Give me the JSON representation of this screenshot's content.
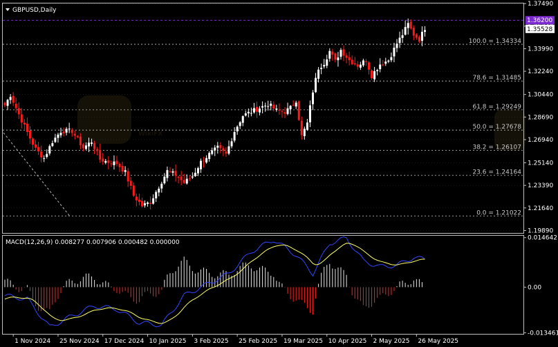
{
  "header": {
    "symbol_label": "GBPUSD,Daily"
  },
  "macd": {
    "label": "MACD(12,26,9) 0.008277 0.007906 0.000482 0.000000"
  },
  "colors": {
    "background": "#000000",
    "frame": "#c0c0c0",
    "grid": "#3a3a3a",
    "bull": "#ffffff",
    "bear": "#ff1a1a",
    "fib": "#c8c8c8",
    "dashed_trend": "#bbbbbb",
    "high_line": "#a040ff",
    "macd_line": "#3344ff",
    "signal_line": "#ffff66",
    "hist_pos": "#e8e8e8",
    "hist_neg": "#ff2020"
  },
  "price_axis": {
    "min": 1.197,
    "max": 1.375,
    "ticks": [
      "1.37490",
      "1.35740",
      "1.33990",
      "1.32240",
      "1.30440",
      "1.28690",
      "1.26940",
      "1.25140",
      "1.23390",
      "1.21640",
      "1.19890"
    ],
    "tick_values": [
      1.3749,
      1.3574,
      1.3399,
      1.3224,
      1.3044,
      1.2869,
      1.2694,
      1.2514,
      1.2339,
      1.2164,
      1.1989
    ]
  },
  "price_badges": [
    {
      "label": "1.36200",
      "value": 1.362,
      "style": "purple"
    },
    {
      "label": "1.35528",
      "value": 1.35528,
      "style": "white"
    }
  ],
  "fib_levels": [
    {
      "label": "100.0 = 1.34334",
      "value": 1.34334
    },
    {
      "label": "78.6 = 1.31485",
      "value": 1.31485
    },
    {
      "label": "61.8 = 1.29249",
      "value": 1.29249
    },
    {
      "label": "50.0 = 1.27678",
      "value": 1.27678
    },
    {
      "label": "38.2 = 1.26107",
      "value": 1.26107
    },
    {
      "label": "23.6 = 1.24164",
      "value": 1.24164
    },
    {
      "label": "0.0 = 1.21022",
      "value": 1.21022
    }
  ],
  "macd_axis": {
    "min": -0.0138,
    "max": 0.0152,
    "ticks": [
      "0.014642",
      "0.00",
      "-0.013461"
    ],
    "tick_values": [
      0.014642,
      0.0,
      -0.013461
    ]
  },
  "date_labels": [
    {
      "label": "1 Nov 2024",
      "bar": 3
    },
    {
      "label": "25 Nov 2024",
      "bar": 19
    },
    {
      "label": "17 Dec 2024",
      "bar": 35
    },
    {
      "label": "10 Jan 2025",
      "bar": 51
    },
    {
      "label": "3 Feb 2025",
      "bar": 67
    },
    {
      "label": "25 Feb 2025",
      "bar": 83
    },
    {
      "label": "19 Mar 2025",
      "bar": 99
    },
    {
      "label": "10 Apr 2025",
      "bar": 115
    },
    {
      "label": "2 May 2025",
      "bar": 131
    },
    {
      "label": "26 May 2025",
      "bar": 147
    }
  ],
  "chart_data": {
    "type": "candlestick",
    "title": "GBPUSD,Daily",
    "ylim": [
      1.197,
      1.375
    ],
    "close_anchors": [
      [
        0,
        1.296
      ],
      [
        2,
        1.304
      ],
      [
        5,
        1.289
      ],
      [
        8,
        1.275
      ],
      [
        11,
        1.262
      ],
      [
        14,
        1.255
      ],
      [
        17,
        1.268
      ],
      [
        20,
        1.276
      ],
      [
        24,
        1.276
      ],
      [
        28,
        1.263
      ],
      [
        31,
        1.268
      ],
      [
        34,
        1.254
      ],
      [
        37,
        1.252
      ],
      [
        40,
        1.251
      ],
      [
        43,
        1.244
      ],
      [
        46,
        1.226
      ],
      [
        49,
        1.218
      ],
      [
        52,
        1.221
      ],
      [
        55,
        1.233
      ],
      [
        58,
        1.245
      ],
      [
        61,
        1.242
      ],
      [
        64,
        1.236
      ],
      [
        67,
        1.241
      ],
      [
        70,
        1.252
      ],
      [
        73,
        1.258
      ],
      [
        76,
        1.263
      ],
      [
        79,
        1.258
      ],
      [
        82,
        1.276
      ],
      [
        85,
        1.288
      ],
      [
        88,
        1.291
      ],
      [
        91,
        1.294
      ],
      [
        94,
        1.297
      ],
      [
        97,
        1.292
      ],
      [
        100,
        1.291
      ],
      [
        102,
        1.294
      ],
      [
        104,
        1.3
      ],
      [
        106,
        1.272
      ],
      [
        108,
        1.282
      ],
      [
        110,
        1.307
      ],
      [
        112,
        1.325
      ],
      [
        114,
        1.329
      ],
      [
        116,
        1.338
      ],
      [
        118,
        1.33
      ],
      [
        120,
        1.339
      ],
      [
        123,
        1.331
      ],
      [
        126,
        1.327
      ],
      [
        129,
        1.331
      ],
      [
        131,
        1.319
      ],
      [
        134,
        1.328
      ],
      [
        137,
        1.331
      ],
      [
        140,
        1.344
      ],
      [
        142,
        1.351
      ],
      [
        144,
        1.359
      ],
      [
        146,
        1.351
      ],
      [
        148,
        1.347
      ],
      [
        150,
        1.356
      ]
    ],
    "macd_anchors": [
      [
        0,
        -0.0025
      ],
      [
        8,
        -0.0035
      ],
      [
        16,
        -0.0118
      ],
      [
        24,
        -0.0085
      ],
      [
        32,
        -0.0055
      ],
      [
        40,
        -0.0065
      ],
      [
        48,
        -0.0105
      ],
      [
        56,
        -0.0112
      ],
      [
        64,
        -0.0025
      ],
      [
        72,
        0.0008
      ],
      [
        80,
        0.004
      ],
      [
        88,
        0.0105
      ],
      [
        96,
        0.014
      ],
      [
        104,
        0.0095
      ],
      [
        110,
        0.004
      ],
      [
        116,
        0.013
      ],
      [
        122,
        0.0145
      ],
      [
        128,
        0.0078
      ],
      [
        134,
        0.006
      ],
      [
        140,
        0.0065
      ],
      [
        146,
        0.0088
      ],
      [
        150,
        0.0082
      ]
    ]
  }
}
